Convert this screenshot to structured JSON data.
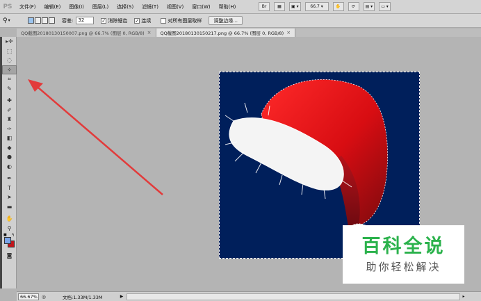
{
  "app": {
    "logo": "PS",
    "menu": [
      "文件(F)",
      "编辑(E)",
      "图像(I)",
      "图层(L)",
      "选择(S)",
      "滤镜(T)",
      "视图(V)",
      "窗口(W)",
      "帮助(H)"
    ],
    "zoom_value": "66.7"
  },
  "options_bar": {
    "tolerance_label": "容差:",
    "tolerance_value": "32",
    "antialias_label": "消除锯齿",
    "contiguous_label": "连续",
    "sample_all_label": "对所有图层取样",
    "refine_edge_label": "调整边缘...",
    "antialias_checked": true,
    "contiguous_checked": true,
    "sample_all_checked": false
  },
  "tabs": [
    {
      "label": "QQ截图20180130150007.png @ 66.7% (图层 0, RGB/8)",
      "active": false
    },
    {
      "label": "QQ截图20180130150217.png @ 66.7% (图层 0, RGB/8)",
      "active": true
    }
  ],
  "colors": {
    "foreground": "#7aa4e8",
    "background": "#c0161c",
    "canvas_bg": "#001f5b",
    "annotation_arrow": "#e23b3b",
    "watermark_green": "#2bb24c"
  },
  "status": {
    "zoom": "66.67%",
    "doc_info": "文档:1.33M/1.33M"
  },
  "watermark": {
    "title": "百科全说",
    "subtitle": "助你轻松解决"
  }
}
